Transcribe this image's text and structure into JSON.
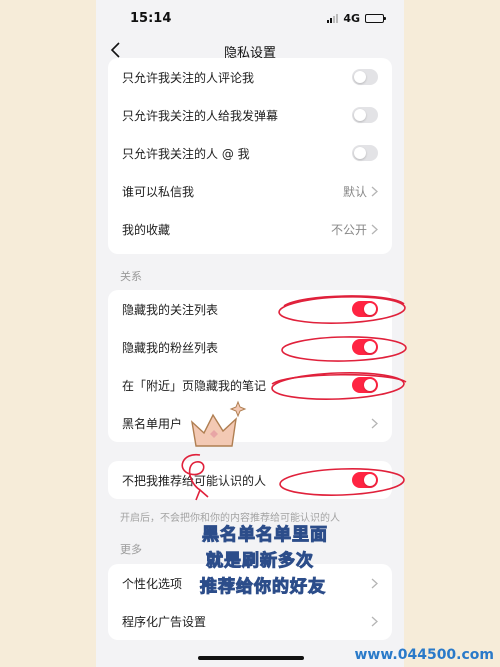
{
  "status_bar": {
    "time": "15:14",
    "network": "4G",
    "battery_level": 0.45
  },
  "nav": {
    "title": "隐私设置"
  },
  "top_rows": [
    {
      "label": "只允许我关注的人评论我",
      "toggle": false
    },
    {
      "label": "只允许我关注的人给我发弹幕",
      "toggle": false
    },
    {
      "label": "只允许我关注的人 @ 我",
      "toggle": false
    },
    {
      "label": "谁可以私信我",
      "value": "默认"
    },
    {
      "label": "我的收藏",
      "value": "不公开"
    }
  ],
  "relations": {
    "section_label": "关系",
    "rows": [
      {
        "label": "隐藏我的关注列表",
        "toggle": true
      },
      {
        "label": "隐藏我的粉丝列表",
        "toggle": true
      },
      {
        "label": "在「附近」页隐藏我的笔记",
        "toggle": true
      },
      {
        "label": "黑名单用户"
      }
    ]
  },
  "recommend": {
    "label": "不把我推荐给可能认识的人",
    "toggle": true,
    "hint": "开启后，不会把你和你的内容推荐给可能认识的人"
  },
  "more": {
    "section_label": "更多",
    "rows": [
      {
        "label": "个性化选项"
      },
      {
        "label": "程序化广告设置"
      }
    ]
  },
  "annotation": {
    "line1": "黑名单名单里面",
    "line2": "就是刷新多次",
    "line3": "推荐给你的好友"
  },
  "watermark": "www.044500.com",
  "colors": {
    "accent": "#ff2442",
    "background": "#f3f3f5",
    "annotation_stroke": "#e0213b"
  }
}
